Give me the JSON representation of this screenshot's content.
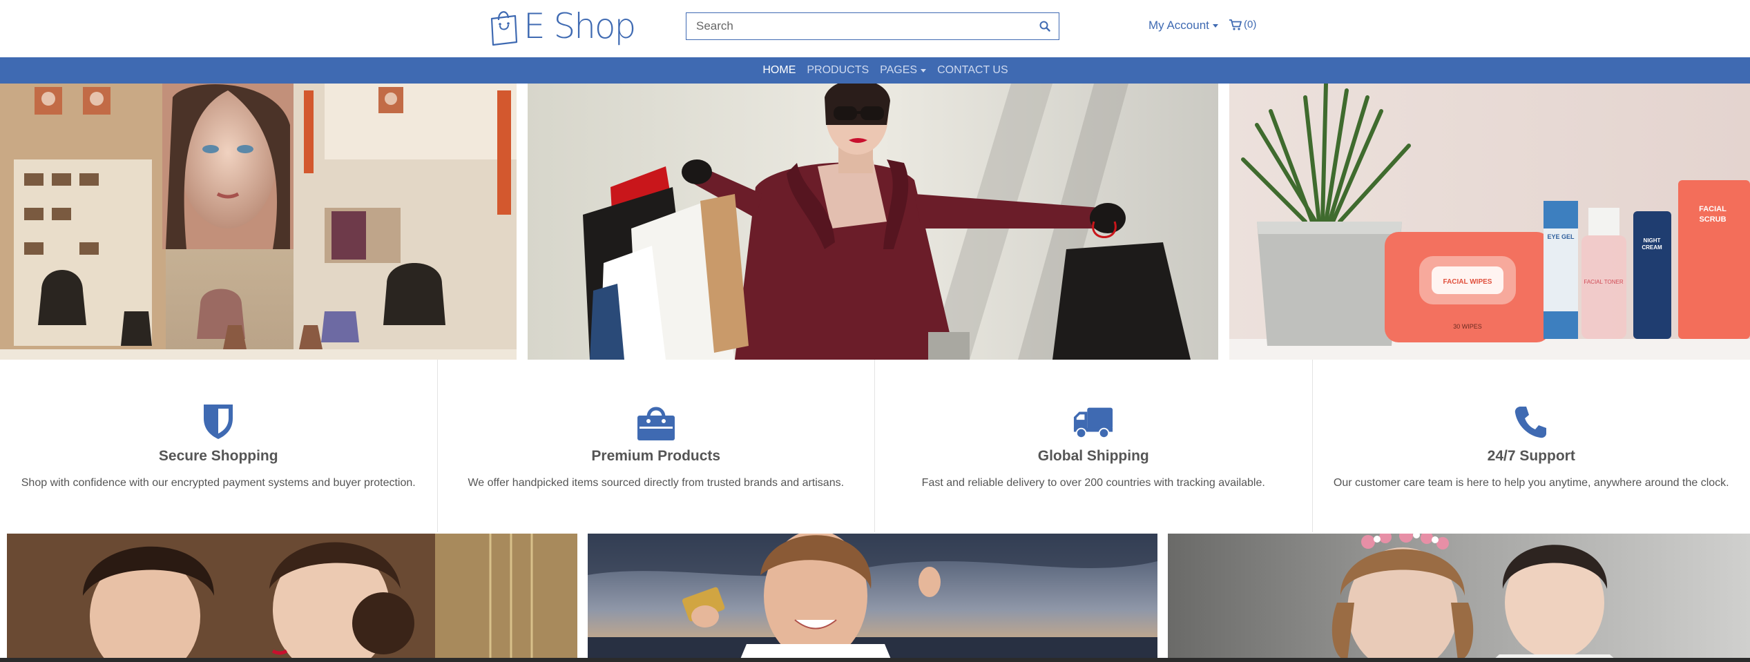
{
  "header": {
    "logo_text": "E Shop",
    "search_placeholder": "Search",
    "account_label": "My Account",
    "cart_count": "(0)"
  },
  "nav": {
    "items": [
      {
        "label": "HOME",
        "active": true
      },
      {
        "label": "PRODUCTS",
        "active": false
      },
      {
        "label": "PAGES",
        "active": false,
        "dropdown": true
      },
      {
        "label": "CONTACT US",
        "active": false
      }
    ]
  },
  "carousel": {
    "slides": [
      {
        "name": "shoe-store-slide"
      },
      {
        "name": "shopping-woman-slide"
      },
      {
        "name": "skincare-products-slide"
      }
    ],
    "dots": 3
  },
  "features": [
    {
      "icon": "shield-icon",
      "title": "Secure Shopping",
      "desc": "Shop with confidence with our encrypted payment systems and buyer protection."
    },
    {
      "icon": "shopping-bag-icon",
      "title": "Premium Products",
      "desc": "We offer handpicked items sourced directly from trusted brands and artisans."
    },
    {
      "icon": "truck-icon",
      "title": "Global Shipping",
      "desc": "Fast and reliable delivery to over 200 countries with tracking available."
    },
    {
      "icon": "phone-icon",
      "title": "24/7 Support",
      "desc": "Our customer care team is here to help you anytime, anywhere around the clock."
    }
  ],
  "colors": {
    "brand": "#3f6ab2",
    "nav_text": "#cfdaf0",
    "text": "#555555"
  }
}
